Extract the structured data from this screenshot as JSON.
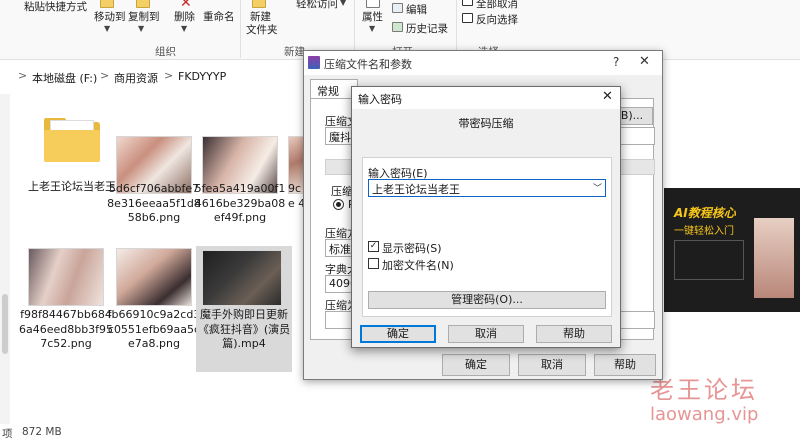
{
  "ribbon": {
    "paste_shortcut": "粘贴快捷方式",
    "move_to": "移动到",
    "copy_to": "复制到",
    "delete": "删除",
    "rename": "重命名",
    "new_folder_line1": "新建",
    "new_folder_line2": "文件夹",
    "easy_access": "轻松访问",
    "properties": "属性",
    "edit": "编辑",
    "history": "历史记录",
    "select_all": "全部取消",
    "invert_select": "反向选择",
    "group_organize": "组织",
    "group_new": "新建",
    "group_open": "打开",
    "group_select": "选择"
  },
  "breadcrumb": {
    "drive": "本地磁盘 (F:)",
    "folder1": "商用资源",
    "folder2": "FKDYYYP",
    "sep": ">"
  },
  "files": [
    {
      "name": "上老王论坛当老王"
    },
    {
      "name": "5d6cf706abbfe78e316eeaa5f1d858b6.png"
    },
    {
      "name": "5fea5a419a00f14616be329ba08ef49f.png"
    },
    {
      "name": "9c 7e 41"
    },
    {
      "name": "f98f84467bb6846a46eed8bb3f957c52.png"
    },
    {
      "name": "fb66910c9a2cd3c0551efb69aa5ce7a8.png"
    },
    {
      "name": "魔手外购即日更新《疯狂抖音》(演员篇).mp4"
    }
  ],
  "status": {
    "items": "项",
    "size": "872 MB"
  },
  "watermark": {
    "cn": "老王论坛",
    "url": "laowang.vip"
  },
  "preview": {
    "banner": "AI教程核心",
    "banner2": "一键轻松入门"
  },
  "winrar": {
    "title": "压缩文件名和参数",
    "help_q": "?",
    "close": "✕",
    "tab_normal": "常规",
    "archive_name_label": "压缩文",
    "archive_name_value": "魔抖满",
    "browse_btn": "B)...",
    "format_label": "压缩文",
    "format_rar": "RA",
    "method_label": "压缩方",
    "method_value": "标准",
    "dict_label": "字典大",
    "dict_value": "4096 K",
    "split_label": "压缩为",
    "ok": "确定",
    "cancel": "取消",
    "help": "帮助"
  },
  "password_dialog": {
    "title": "输入密码",
    "close": "✕",
    "subtitle": "带密码压缩",
    "input_label": "输入密码(E)",
    "input_value": "上老王论坛当老王",
    "show_password": "显示密码(S)",
    "show_password_checked": true,
    "encrypt_names": "加密文件名(N)",
    "encrypt_names_checked": false,
    "manage": "管理密码(O)...",
    "ok": "确定",
    "cancel": "取消",
    "help": "帮助"
  }
}
